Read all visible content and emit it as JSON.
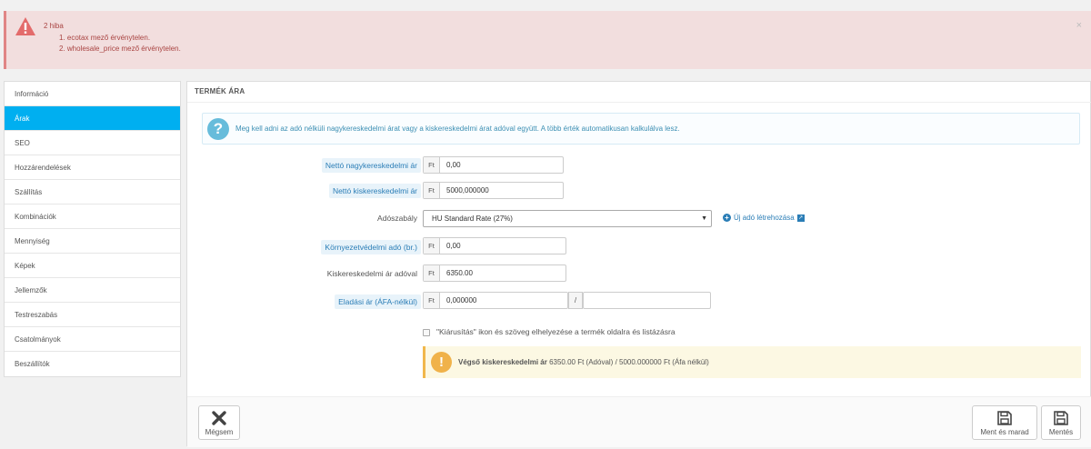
{
  "alert": {
    "title": "2 hiba",
    "errors": [
      "1.  ecotax mező érvénytelen.",
      "2.  wholesale_price mező érvénytelen."
    ],
    "close": "×"
  },
  "sidebar": {
    "items": [
      {
        "label": "Információ"
      },
      {
        "label": "Árak",
        "active": true
      },
      {
        "label": "SEO"
      },
      {
        "label": "Hozzárendelések"
      },
      {
        "label": "Szállítás"
      },
      {
        "label": "Kombinációk"
      },
      {
        "label": "Mennyiség"
      },
      {
        "label": "Képek"
      },
      {
        "label": "Jellemzők"
      },
      {
        "label": "Testreszabás"
      },
      {
        "label": "Csatolmányok"
      },
      {
        "label": "Beszállítók"
      }
    ]
  },
  "panel": {
    "heading": "TERMÉK ÁRA",
    "info_text": "Meg kell adni az adó nélküli nagykereskedelmi árat vagy a kiskereskedelmi árat adóval együtt. A több érték automatikusan kalkulálva lesz.",
    "currency": "Ft",
    "fields": {
      "wholesale": {
        "label": "Nettó nagykereskedelmi ár",
        "value": "0,00"
      },
      "retail": {
        "label": "Nettó kiskereskedelmi ár",
        "value": "5000,000000"
      },
      "tax_rule": {
        "label": "Adószabály",
        "value": "HU Standard Rate (27%)",
        "new_link": "Új adó létrehozása"
      },
      "ecotax": {
        "label": "Környezetvédelmi adó (br.)",
        "value": "0,00"
      },
      "retail_with_tax": {
        "label": "Kiskereskedelmi ár adóval",
        "value": "6350.00"
      },
      "unit_price": {
        "label": "Eladási ár (ÁFA-nélkül)",
        "value": "0,000000",
        "slash": "/",
        "unit_value": ""
      }
    },
    "on_sale_label": "\"Kiárusítás\" ikon és szöveg elhelyezése a termék oldalra és listázásra",
    "final_price_label": "Végső kiskereskedelmi ár",
    "final_price_text": "6350.00 Ft (Adóval) / 5000.000000 Ft (Áfa nélkül)"
  },
  "footer": {
    "cancel": "Mégsem",
    "save_stay": "Ment és marad",
    "save": "Mentés"
  },
  "colors": {
    "accent": "#00aff0",
    "error_bg": "#f2dede",
    "error_text": "#a94442",
    "info_text": "#3c8fb3",
    "warning": "#f0b24a"
  }
}
